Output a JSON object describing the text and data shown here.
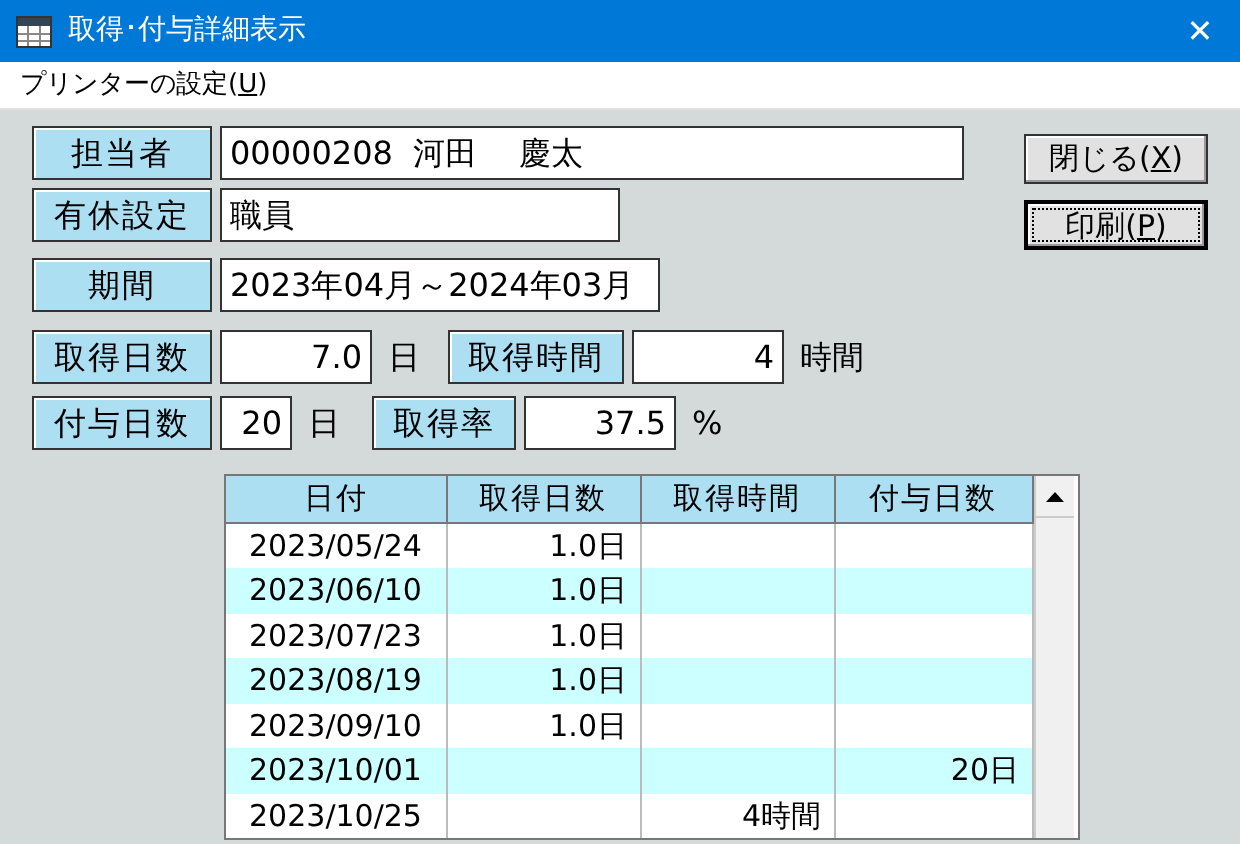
{
  "window": {
    "title": "取得･付与詳細表示",
    "close": "✕"
  },
  "menu": [
    {
      "before": "プリンターの設定(",
      "key": "U",
      "after": ")"
    }
  ],
  "fields": [
    {
      "label": "担当者",
      "value": "00000208  河田　 慶太",
      "kind": "wide"
    },
    {
      "label": "有休設定",
      "value": "職員",
      "kind": "medium"
    },
    {
      "label": "期間",
      "value": "2023年04月～2024年03月",
      "kind": "period"
    }
  ],
  "stats": [
    [
      {
        "label": "取得日数",
        "value": "7.0",
        "unit": "日",
        "kind": "mid"
      },
      {
        "label": "取得時間",
        "value": "4",
        "unit": "時間",
        "kind": "mid"
      }
    ],
    [
      {
        "label": "付与日数",
        "value": "20",
        "unit": "日",
        "kind": "short"
      },
      {
        "label": "取得率",
        "value": "37.5",
        "unit": "%",
        "kind": "mid"
      }
    ]
  ],
  "buttons": [
    {
      "before": "閉じる(",
      "key": "X",
      "after": ")",
      "focused": false
    },
    {
      "before": "印刷(",
      "key": "P",
      "after": ")",
      "focused": true
    }
  ],
  "table": {
    "columns": [
      "日付",
      "取得日数",
      "取得時間",
      "付与日数"
    ],
    "rows": [
      [
        "2023/05/24",
        "1.0日",
        "",
        ""
      ],
      [
        "2023/06/10",
        "1.0日",
        "",
        ""
      ],
      [
        "2023/07/23",
        "1.0日",
        "",
        ""
      ],
      [
        "2023/08/19",
        "1.0日",
        "",
        ""
      ],
      [
        "2023/09/10",
        "1.0日",
        "",
        ""
      ],
      [
        "2023/10/01",
        "",
        "",
        "20日"
      ],
      [
        "2023/10/25",
        "",
        "4時間",
        ""
      ]
    ]
  }
}
